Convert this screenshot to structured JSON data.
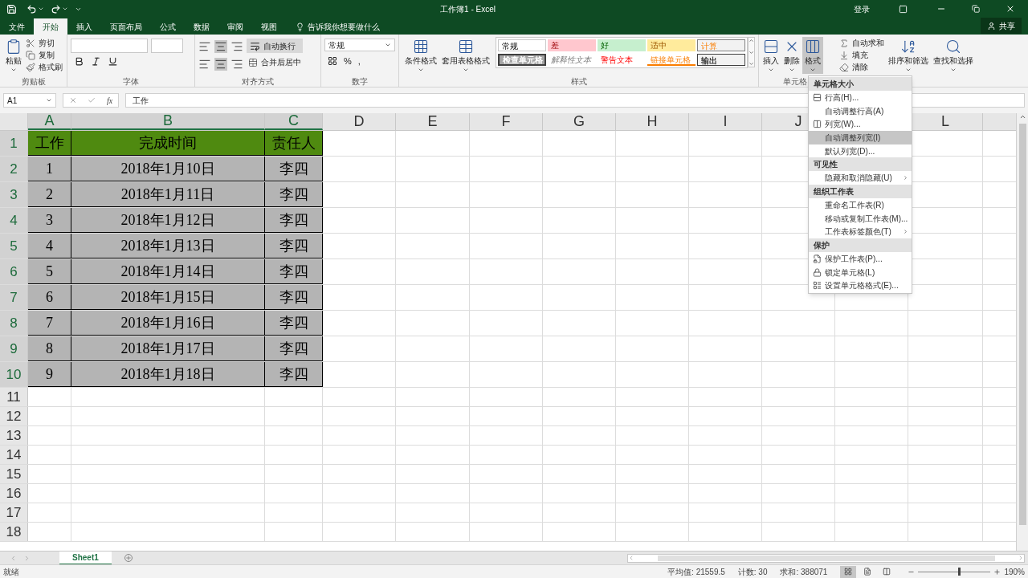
{
  "title_bar": {
    "title": "工作簿1 - Excel",
    "login": "登录",
    "share": "共享"
  },
  "tabs": [
    {
      "label": "文件",
      "selected": false
    },
    {
      "label": "开始",
      "selected": true
    },
    {
      "label": "插入",
      "selected": false
    },
    {
      "label": "页面布局",
      "selected": false
    },
    {
      "label": "公式",
      "selected": false
    },
    {
      "label": "数据",
      "selected": false
    },
    {
      "label": "审阅",
      "selected": false
    },
    {
      "label": "视图",
      "selected": false
    }
  ],
  "tell_me": "告诉我你想要做什么",
  "ribbon": {
    "clipboard": {
      "paste": "粘贴",
      "cut": "剪切",
      "copy": "复制",
      "painter": "格式刷",
      "label": "剪贴板"
    },
    "font": {
      "label": "字体"
    },
    "alignment": {
      "wrap": "自动换行",
      "merge": "合并后居中",
      "label": "对齐方式"
    },
    "number": {
      "format": "常规",
      "percent": "%",
      "comma": ",",
      "label": "数字"
    },
    "styles": {
      "conditional": "条件格式",
      "table": "套用表格格式",
      "label": "样式",
      "cell_styles": [
        {
          "label": "常规",
          "kind": "normal"
        },
        {
          "label": "差",
          "kind": "bad"
        },
        {
          "label": "好",
          "kind": "good"
        },
        {
          "label": "适中",
          "kind": "neutral"
        },
        {
          "label": "计算",
          "kind": "calculation"
        },
        {
          "label": "检查单元格",
          "kind": "check"
        },
        {
          "label": "解释性文本",
          "kind": "explanatory"
        },
        {
          "label": "警告文本",
          "kind": "warning"
        },
        {
          "label": "链接单元格",
          "kind": "linked"
        },
        {
          "label": "输出",
          "kind": "output"
        }
      ]
    },
    "cells": {
      "insert": "插入",
      "delete": "删除",
      "format": "格式",
      "format_pressed": true,
      "label": "单元格"
    },
    "editing": {
      "autosum": "自动求和",
      "fill": "填充",
      "clear": "清除",
      "sort": "排序和筛选",
      "find": "查找和选择"
    }
  },
  "name_box": "A1",
  "fx": "fx",
  "formula": "工作",
  "columns": [
    {
      "label": "A",
      "selected": true
    },
    {
      "label": "B",
      "selected": true
    },
    {
      "label": "C",
      "selected": true
    },
    {
      "label": "D",
      "selected": false
    },
    {
      "label": "E",
      "selected": false
    },
    {
      "label": "F",
      "selected": false
    },
    {
      "label": "G",
      "selected": false
    },
    {
      "label": "H",
      "selected": false
    },
    {
      "label": "I",
      "selected": false
    },
    {
      "label": "J",
      "selected": false
    },
    {
      "label": "L",
      "selected": false
    }
  ],
  "rows": [
    {
      "number": "1",
      "selected": true,
      "kind": "header",
      "cells": [
        "工作",
        "完成时间",
        "责任人"
      ]
    },
    {
      "number": "2",
      "selected": true,
      "kind": "data",
      "cells": [
        "1",
        "2018年1月10日",
        "李四"
      ]
    },
    {
      "number": "3",
      "selected": true,
      "kind": "data",
      "cells": [
        "2",
        "2018年1月11日",
        "李四"
      ]
    },
    {
      "number": "4",
      "selected": true,
      "kind": "data",
      "cells": [
        "3",
        "2018年1月12日",
        "李四"
      ]
    },
    {
      "number": "5",
      "selected": true,
      "kind": "data",
      "cells": [
        "4",
        "2018年1月13日",
        "李四"
      ]
    },
    {
      "number": "6",
      "selected": true,
      "kind": "data",
      "cells": [
        "5",
        "2018年1月14日",
        "李四"
      ]
    },
    {
      "number": "7",
      "selected": true,
      "kind": "data",
      "cells": [
        "6",
        "2018年1月15日",
        "李四"
      ]
    },
    {
      "number": "8",
      "selected": true,
      "kind": "data",
      "cells": [
        "7",
        "2018年1月16日",
        "李四"
      ]
    },
    {
      "number": "9",
      "selected": true,
      "kind": "data",
      "cells": [
        "8",
        "2018年1月17日",
        "李四"
      ]
    },
    {
      "number": "10",
      "selected": true,
      "kind": "data",
      "cells": [
        "9",
        "2018年1月18日",
        "李四"
      ]
    },
    {
      "number": "11",
      "selected": false,
      "kind": "empty"
    },
    {
      "number": "12",
      "selected": false,
      "kind": "empty"
    },
    {
      "number": "13",
      "selected": false,
      "kind": "empty"
    },
    {
      "number": "14",
      "selected": false,
      "kind": "empty"
    },
    {
      "number": "15",
      "selected": false,
      "kind": "empty"
    },
    {
      "number": "16",
      "selected": false,
      "kind": "empty"
    },
    {
      "number": "17",
      "selected": false,
      "kind": "empty"
    },
    {
      "number": "18",
      "selected": false,
      "kind": "empty"
    }
  ],
  "menu": [
    {
      "kind": "heading",
      "label": "单元格大小"
    },
    {
      "kind": "item",
      "label": "行高(H)...",
      "highlighted": false,
      "submenu": false
    },
    {
      "kind": "item",
      "label": "自动调整行高(A)",
      "highlighted": false,
      "submenu": false
    },
    {
      "kind": "item",
      "label": "列宽(W)...",
      "highlighted": false,
      "submenu": false
    },
    {
      "kind": "item",
      "label": "自动调整列宽(I)",
      "highlighted": true,
      "submenu": false
    },
    {
      "kind": "item",
      "label": "默认列宽(D)...",
      "highlighted": false,
      "submenu": false
    },
    {
      "kind": "heading",
      "label": "可见性"
    },
    {
      "kind": "item",
      "label": "隐藏和取消隐藏(U)",
      "highlighted": false,
      "submenu": true
    },
    {
      "kind": "heading",
      "label": "组织工作表"
    },
    {
      "kind": "item",
      "label": "重命名工作表(R)",
      "highlighted": false,
      "submenu": false
    },
    {
      "kind": "item",
      "label": "移动或复制工作表(M)...",
      "highlighted": false,
      "submenu": false
    },
    {
      "kind": "item",
      "label": "工作表标签颜色(T)",
      "highlighted": false,
      "submenu": true
    },
    {
      "kind": "heading",
      "label": "保护"
    },
    {
      "kind": "item",
      "label": "保护工作表(P)...",
      "highlighted": false,
      "submenu": false
    },
    {
      "kind": "item",
      "label": "锁定单元格(L)",
      "highlighted": false,
      "submenu": false
    },
    {
      "kind": "item",
      "label": "设置单元格格式(E)...",
      "highlighted": false,
      "submenu": false
    }
  ],
  "sheet_tabs": [
    {
      "label": "Sheet1",
      "selected": true
    }
  ],
  "status_bar": {
    "state": "就绪",
    "average": "平均值: 21559.5",
    "count": "计数: 30",
    "sum": "求和: 388071",
    "views": [
      {
        "selected": true
      },
      {
        "selected": false
      },
      {
        "selected": false
      }
    ],
    "zoom": {
      "label": "190%",
      "level": 0.55
    }
  }
}
